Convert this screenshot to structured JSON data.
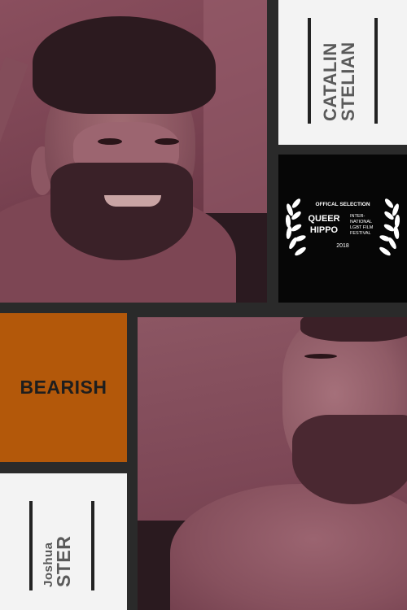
{
  "title": "BEARISH",
  "cast_top": {
    "first": "CATALIN",
    "last": "STELIAN"
  },
  "cast_bottom": {
    "first": "Joshua",
    "last": "STER"
  },
  "laurel": {
    "heading": "OFFICAL SELECTION",
    "festival_line1": "QUEER",
    "festival_line2": "HIPPO",
    "festival_sub1": "INTER-",
    "festival_sub2": "NATIONAL",
    "festival_sub3": "LGBT FILM",
    "festival_sub4": "FESTIVAL",
    "year": "2018"
  },
  "colors": {
    "orange": "#b3580a",
    "photo_tint": "#7a4352",
    "card_white": "#f3f3f3",
    "frame": "#2a2a2a"
  }
}
